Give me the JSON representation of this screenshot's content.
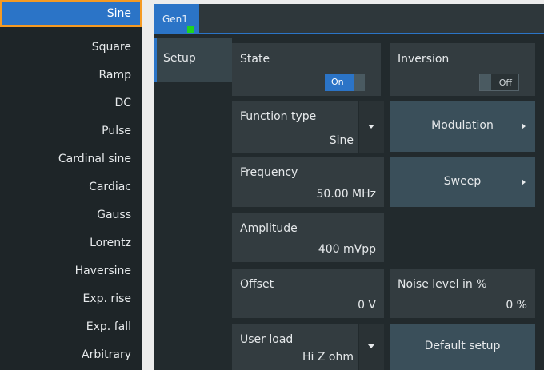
{
  "functions": {
    "items": [
      "Sine",
      "Square",
      "Ramp",
      "DC",
      "Pulse",
      "Cardinal sine",
      "Cardiac",
      "Gauss",
      "Lorentz",
      "Haversine",
      "Exp. rise",
      "Exp. fall",
      "Arbitrary"
    ],
    "selected": "Sine"
  },
  "tab": {
    "label": "Gen1"
  },
  "side_tab": {
    "label": "Setup"
  },
  "state": {
    "label": "State",
    "toggle": "On"
  },
  "inversion": {
    "label": "Inversion",
    "toggle": "Off"
  },
  "function_type": {
    "label": "Function type",
    "value": "Sine"
  },
  "modulation": {
    "label": "Modulation"
  },
  "frequency": {
    "label": "Frequency",
    "value": "50.00 MHz"
  },
  "sweep": {
    "label": "Sweep"
  },
  "amplitude": {
    "label": "Amplitude",
    "value": "400 mVpp"
  },
  "offset": {
    "label": "Offset",
    "value": "0 V"
  },
  "noise": {
    "label": "Noise level in %",
    "value": "0 %"
  },
  "user_load": {
    "label": "User load",
    "value": "Hi Z ohm"
  },
  "default_setup": {
    "label": "Default setup"
  },
  "colors": {
    "accent": "#2b74c7",
    "selection_border": "#f59a23",
    "active_indicator": "#1fd41f"
  }
}
